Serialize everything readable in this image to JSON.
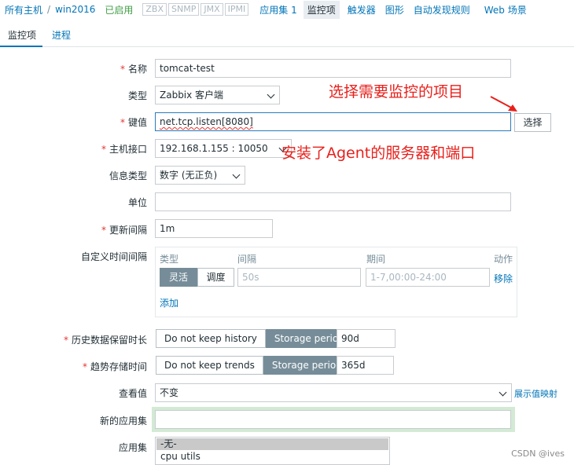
{
  "topnav": {
    "all_hosts": "所有主机",
    "host": "win2016",
    "status": "已启用",
    "availability": [
      "ZBX",
      "SNMP",
      "JMX",
      "IPMI"
    ],
    "links": [
      "应用集 1",
      "监控项",
      "触发器",
      "图形",
      "自动发现规则",
      "Web 场景"
    ]
  },
  "tabs": [
    "监控项",
    "进程"
  ],
  "form": {
    "name": {
      "label": "名称",
      "value": "tomcat-test"
    },
    "type": {
      "label": "类型",
      "value": "Zabbix 客户端"
    },
    "key": {
      "label": "键值",
      "value": "net.tcp.listen[8080]",
      "button": "选择"
    },
    "interface": {
      "label": "主机接口",
      "value": "192.168.1.155 : 10050"
    },
    "info_type": {
      "label": "信息类型",
      "value": "数字 (无正负)"
    },
    "units": {
      "label": "单位",
      "value": ""
    },
    "update_interval": {
      "label": "更新间隔",
      "value": "1m"
    },
    "custom_intervals": {
      "label": "自定义时间间隔",
      "headers": [
        "类型",
        "间隔",
        "期间",
        "动作"
      ],
      "seg_flexible": "灵活",
      "seg_scheduling": "调度",
      "interval_placeholder": "50s",
      "period_placeholder": "1-7,00:00-24:00",
      "remove": "移除",
      "add": "添加"
    },
    "history": {
      "label": "历史数据保留时长",
      "off": "Do not keep history",
      "on": "Storage period",
      "value": "90d"
    },
    "trends": {
      "label": "趋势存储时间",
      "off": "Do not keep trends",
      "on": "Storage period",
      "value": "365d"
    },
    "show_value": {
      "label": "查看值",
      "value": "不变",
      "link": "展示值映射"
    },
    "new_app": {
      "label": "新的应用集",
      "value": ""
    },
    "apps": {
      "label": "应用集",
      "options": [
        "-无-",
        "cpu utils"
      ]
    }
  },
  "annotations": {
    "select_item": "选择需要监控的项目",
    "agent_server": "安装了Agent的服务器和端口"
  },
  "watermark": "CSDN @ives",
  "colors": {
    "link": "#0275b8",
    "enabled": "#429e47",
    "required": "#e33734",
    "annotation": "#e8201b",
    "segment_on": "#768d99"
  }
}
